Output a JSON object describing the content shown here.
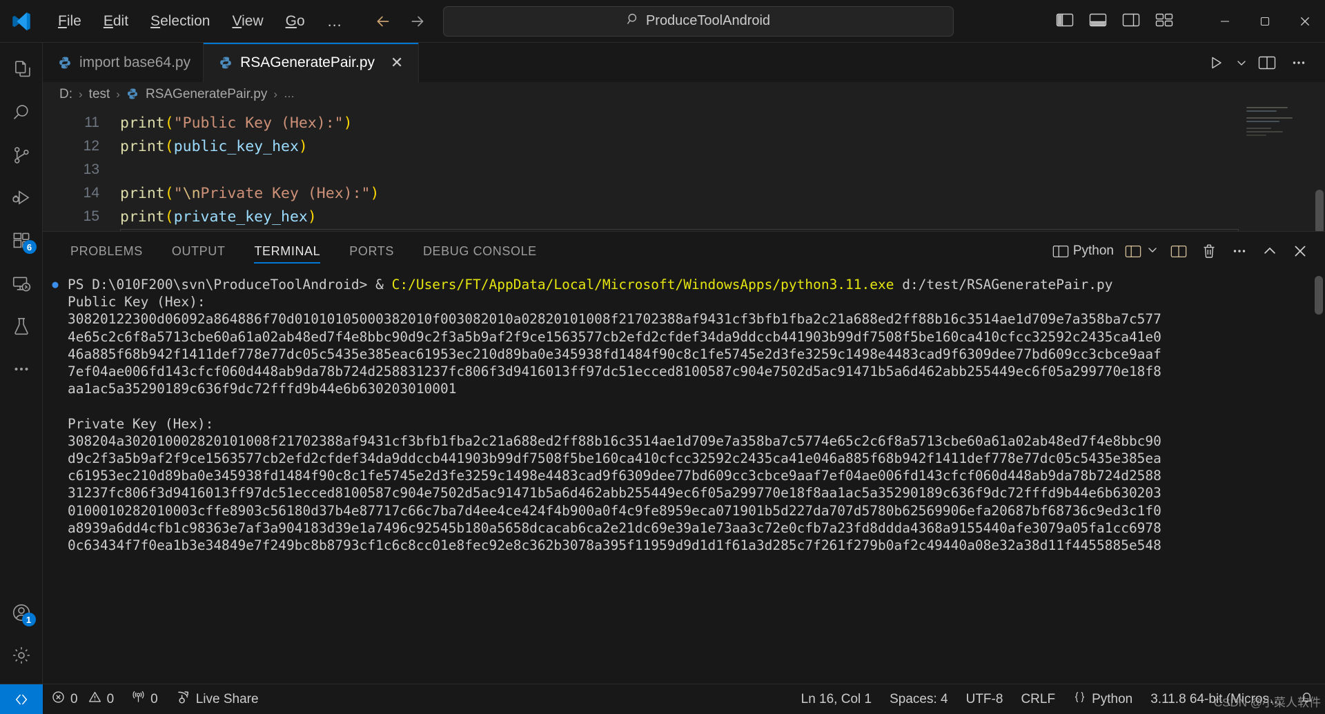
{
  "titlebar": {
    "menu": [
      {
        "label": "File",
        "accel": "F"
      },
      {
        "label": "Edit",
        "accel": "E"
      },
      {
        "label": "Selection",
        "accel": "S"
      },
      {
        "label": "View",
        "accel": "V"
      },
      {
        "label": "Go",
        "accel": "G"
      }
    ],
    "more_label": "…",
    "back_label": "←",
    "forward_label": "→",
    "search_value": "ProduceToolAndroid",
    "search_icon": "search-icon",
    "minimize_label": "─",
    "maximize_label": "☐",
    "close_label": "✕"
  },
  "activitybar": {
    "items": [
      {
        "name": "explorer",
        "icon": "files-icon",
        "badge": ""
      },
      {
        "name": "search",
        "icon": "search-icon",
        "badge": ""
      },
      {
        "name": "source-control",
        "icon": "source-control-icon",
        "badge": ""
      },
      {
        "name": "run-and-debug",
        "icon": "run-debug-icon",
        "badge": ""
      },
      {
        "name": "extensions",
        "icon": "extensions-icon",
        "badge": "6"
      },
      {
        "name": "remote-explorer",
        "icon": "remote-explorer-icon",
        "badge": ""
      },
      {
        "name": "testing",
        "icon": "beaker-icon",
        "badge": ""
      },
      {
        "name": "more-views",
        "icon": "ellipsis-icon",
        "badge": ""
      }
    ],
    "bottom": [
      {
        "name": "accounts",
        "icon": "account-icon",
        "badge": "1"
      },
      {
        "name": "manage",
        "icon": "gear-icon",
        "badge": ""
      }
    ]
  },
  "tabs": [
    {
      "label": "import base64.py",
      "icon": "python-icon",
      "active": false
    },
    {
      "label": "RSAGeneratePair.py",
      "icon": "python-icon",
      "active": true,
      "close_label": "✕"
    }
  ],
  "editor_actions": {
    "run_label": "▷",
    "run_chevron": "⌄",
    "split_label": "split-editor",
    "more_label": "⋯"
  },
  "breadcrumb": {
    "items": [
      "D:",
      "test",
      "RSAGeneratePair.py",
      "…"
    ],
    "separator": "›"
  },
  "code": {
    "lines": [
      {
        "num": "11",
        "tokens": [
          {
            "t": "print",
            "c": "fn"
          },
          {
            "t": "(",
            "c": "par"
          },
          {
            "t": "\"Public Key (Hex):\"",
            "c": "str"
          },
          {
            "t": ")",
            "c": "par"
          }
        ]
      },
      {
        "num": "12",
        "tokens": [
          {
            "t": "print",
            "c": "fn"
          },
          {
            "t": "(",
            "c": "par"
          },
          {
            "t": "public_key_hex",
            "c": "var"
          },
          {
            "t": ")",
            "c": "par"
          }
        ]
      },
      {
        "num": "13",
        "tokens": []
      },
      {
        "num": "14",
        "tokens": [
          {
            "t": "print",
            "c": "fn"
          },
          {
            "t": "(",
            "c": "par"
          },
          {
            "t": "\"",
            "c": "str"
          },
          {
            "t": "\\n",
            "c": "esc"
          },
          {
            "t": "Private Key (Hex):\"",
            "c": "str"
          },
          {
            "t": ")",
            "c": "par"
          }
        ]
      },
      {
        "num": "15",
        "tokens": [
          {
            "t": "print",
            "c": "fn"
          },
          {
            "t": "(",
            "c": "par"
          },
          {
            "t": "private_key_hex",
            "c": "var"
          },
          {
            "t": ")",
            "c": "par"
          }
        ]
      },
      {
        "num": "16",
        "tokens": [],
        "current": true
      }
    ]
  },
  "panel": {
    "tabs": [
      {
        "label": "PROBLEMS",
        "active": false
      },
      {
        "label": "OUTPUT",
        "active": false
      },
      {
        "label": "TERMINAL",
        "active": true
      },
      {
        "label": "PORTS",
        "active": false
      },
      {
        "label": "DEBUG CONSOLE",
        "active": false
      }
    ],
    "actions": {
      "terminal_name": "Python",
      "terminal_icon": "split-panel-icon",
      "new_terminal_icon": "new-terminal-icon",
      "chevron_down": "⌄",
      "split_icon": "split-terminal-icon",
      "kill_icon": "trash-icon",
      "more_icon": "⋯",
      "maximize_icon": "⌃",
      "close_icon": "✕"
    }
  },
  "terminal": {
    "prompt": "PS D:\\010F200\\svn\\ProduceToolAndroid> & ",
    "command_path": "C:/Users/FT/AppData/Local/Microsoft/WindowsApps/python3.11.exe",
    "command_arg": " d:/test/RSAGeneratePair.py",
    "lines": [
      "Public Key (Hex):",
      "30820122300d06092a864886f70d01010105000382010f003082010a02820101008f21702388af9431cf3bfb1fba2c21a688ed2ff88b16c3514ae1d709e7a358ba7c577",
      "4e65c2c6f8a5713cbe60a61a02ab48ed7f4e8bbc90d9c2f3a5b9af2f9ce1563577cb2efd2cfdef34da9ddccb441903b99df7508f5be160ca410cfcc32592c2435ca41e0",
      "46a885f68b942f1411def778e77dc05c5435e385eac61953ec210d89ba0e345938fd1484f90c8c1fe5745e2d3fe3259c1498e4483cad9f6309dee77bd609cc3cbce9aaf",
      "7ef04ae006fd143cfcf060d448ab9da78b724d258831237fc806f3d9416013ff97dc51ecced8100587c904e7502d5ac91471b5a6d462abb255449ec6f05a299770e18f8",
      "aa1ac5a35290189c636f9dc72fffd9b44e6b630203010001",
      "",
      "Private Key (Hex):",
      "308204a302010002820101008f21702388af9431cf3bfb1fba2c21a688ed2ff88b16c3514ae1d709e7a358ba7c5774e65c2c6f8a5713cbe60a61a02ab48ed7f4e8bbc90",
      "d9c2f3a5b9af2f9ce1563577cb2efd2cfdef34da9ddccb441903b99df7508f5be160ca410cfcc32592c2435ca41e046a885f68b942f1411def778e77dc05c5435e385ea",
      "c61953ec210d89ba0e345938fd1484f90c8c1fe5745e2d3fe3259c1498e4483cad9f6309dee77bd609cc3cbce9aaf7ef04ae006fd143cfcf060d448ab9da78b724d2588",
      "31237fc806f3d9416013ff97dc51ecced8100587c904e7502d5ac91471b5a6d462abb255449ec6f05a299770e18f8aa1ac5a35290189c636f9dc72fffd9b44e6b630203",
      "0100010282010003cffe8903c56180d37b4e87717c66c7ba7d4ee4ce424f4b900a0f4c9fe8959eca071901b5d227da707d5780b62569906efa20687bf68736c9ed3c1f0",
      "a8939a6dd4cfb1c98363e7af3a904183d39e1a7496c92545b180a5658dcacab6ca2e21dc69e39a1e73aa3c72e0cfb7a23fd8ddda4368a9155440afe3079a05fa1cc6978",
      "0c63434f7f0ea1b3e34849e7f249bc8b8793cf1c6c8cc01e8fec92e8c362b3078a395f11959d9d1d1f61a3d285c7f261f279b0af2c49440a08e32a38d11f4455885e548"
    ]
  },
  "statusbar": {
    "remote_icon": "remote-window-icon",
    "left": [
      {
        "icon": "error-icon",
        "label": "0"
      },
      {
        "icon": "warning-icon",
        "label": "0"
      },
      {
        "icon": "radio-tower-icon",
        "label": "0"
      },
      {
        "icon": "live-share-icon",
        "label": "Live Share"
      }
    ],
    "right": [
      {
        "label": "Ln 16, Col 1"
      },
      {
        "label": "Spaces: 4"
      },
      {
        "label": "UTF-8"
      },
      {
        "label": "CRLF"
      },
      {
        "icon": "braces-icon",
        "label": "Python"
      },
      {
        "label": "3.11.8 64-bit (Micros…"
      },
      {
        "icon": "bell-icon",
        "label": ""
      }
    ]
  },
  "watermark": "CSDN @小菜人软件"
}
